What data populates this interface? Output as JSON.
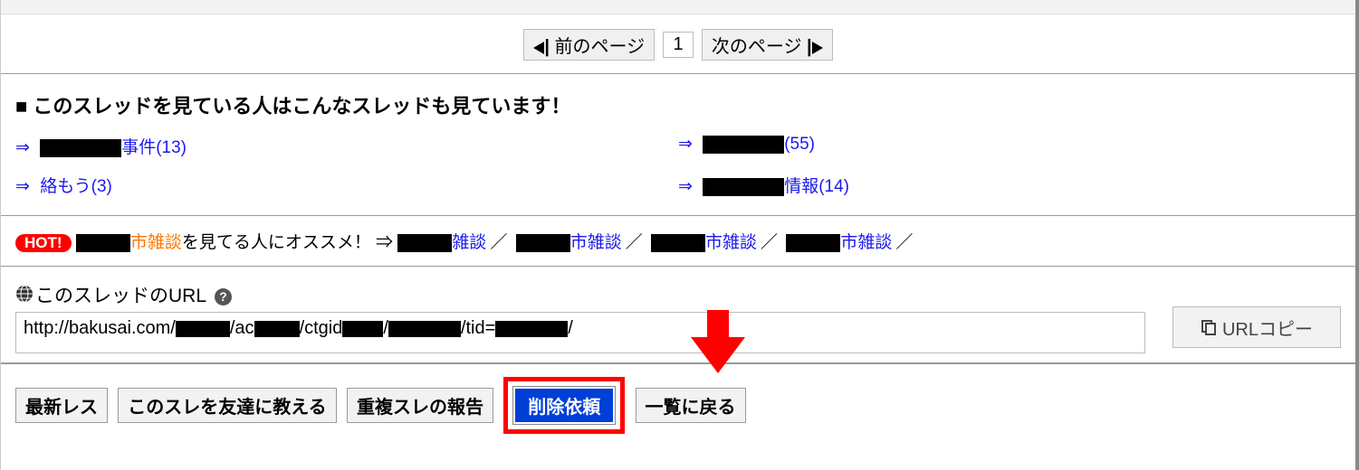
{
  "paginator": {
    "prev": "前のページ",
    "page": "1",
    "next": "次のページ"
  },
  "related": {
    "heading": "■ このスレッドを見ている人はこんなスレッドも見ています！",
    "items": [
      {
        "suffix": "事件",
        "count": "(13)"
      },
      {
        "suffix": "",
        "count": "(55)"
      },
      {
        "suffix": "絡もう",
        "count": "(3)",
        "noredact": true
      },
      {
        "suffix": "情報",
        "count": "(14)"
      }
    ]
  },
  "hot": {
    "badge": "HOT!",
    "topic_suffix": "市雑談",
    "tail": "を見てる人にオススメ！ ⇒",
    "recs": [
      {
        "suffix": "雑談"
      },
      {
        "suffix": "市雑談"
      },
      {
        "suffix": "市雑談"
      },
      {
        "suffix": "市雑談"
      }
    ]
  },
  "url": {
    "label": "このスレッドのURL",
    "parts": [
      "http://bakusai.com/",
      "/ac",
      "/ctgid",
      "/",
      "/tid=",
      "/"
    ],
    "copy": "URLコピー"
  },
  "buttons": {
    "latest": "最新レス",
    "share": "このスレを友達に教える",
    "dup": "重複スレの報告",
    "delete": "削除依頼",
    "back": "一覧に戻る"
  }
}
